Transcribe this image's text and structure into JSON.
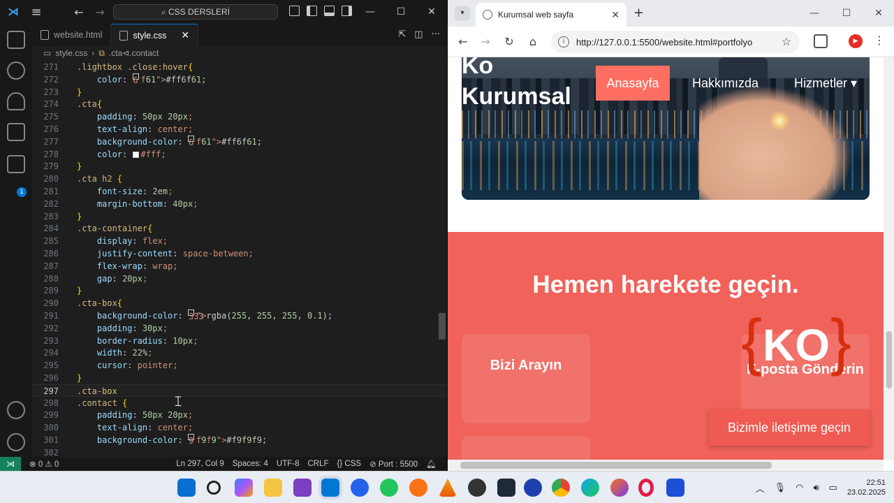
{
  "vscode": {
    "search": "CSS DERSLERİ",
    "tabs": [
      {
        "label": "website.html"
      },
      {
        "label": "style.css"
      }
    ],
    "breadcrumb": {
      "file": "style.css",
      "symbol": ".cta⊲.contact"
    },
    "code_lines": [
      {
        "n": "271",
        "text": ".lightbox .close:hover{"
      },
      {
        "n": "272",
        "text": "    color: #ff6f61;"
      },
      {
        "n": "273",
        "text": "}"
      },
      {
        "n": "274",
        "text": ".cta{"
      },
      {
        "n": "275",
        "text": "    padding: 50px 20px;"
      },
      {
        "n": "276",
        "text": "    text-align: center;"
      },
      {
        "n": "277",
        "text": "    background-color: #ff6f61;"
      },
      {
        "n": "278",
        "text": "    color: #fff;"
      },
      {
        "n": "279",
        "text": "}"
      },
      {
        "n": "280",
        "text": ".cta h2 {"
      },
      {
        "n": "281",
        "text": "    font-size: 2em;"
      },
      {
        "n": "282",
        "text": "    margin-bottom: 40px;"
      },
      {
        "n": "283",
        "text": "}"
      },
      {
        "n": "284",
        "text": ".cta-container{"
      },
      {
        "n": "285",
        "text": "    display: flex;"
      },
      {
        "n": "286",
        "text": "    justify-content: space-between;"
      },
      {
        "n": "287",
        "text": "    flex-wrap: wrap;"
      },
      {
        "n": "288",
        "text": "    gap: 20px;"
      },
      {
        "n": "289",
        "text": "}"
      },
      {
        "n": "290",
        "text": ".cta-box{"
      },
      {
        "n": "291",
        "text": "    background-color: rgba(255, 255, 255, 0.1);"
      },
      {
        "n": "292",
        "text": "    padding: 30px;"
      },
      {
        "n": "293",
        "text": "    border-radius: 10px;"
      },
      {
        "n": "294",
        "text": "    width: 22%;"
      },
      {
        "n": "295",
        "text": "    cursor: pointer;"
      },
      {
        "n": "296",
        "text": "}"
      },
      {
        "n": "297",
        "text": ".cta-box"
      },
      {
        "n": "298",
        "text": ".contact {"
      },
      {
        "n": "299",
        "text": "    padding: 50px 20px;"
      },
      {
        "n": "300",
        "text": "    text-align: center;"
      },
      {
        "n": "301",
        "text": "    background-color: #f9f9f9;"
      },
      {
        "n": "302",
        "text": ""
      }
    ],
    "status": {
      "problems": "⊗ 0 ⚠ 0",
      "position": "Ln 297, Col 9",
      "spaces": "Spaces: 4",
      "encoding": "UTF-8",
      "eol": "CRLF",
      "language": "{} CSS",
      "port": "⊘ Port : 5500"
    },
    "activity_badge": "1"
  },
  "browser": {
    "tab_title": "Kurumsal web sayfa",
    "url": "http://127.0.0.1:5500/website.html#portfolyo",
    "site": {
      "logo_line1": "Ko",
      "logo_line2": "Kurumsal",
      "nav": [
        "Anasayfa",
        "Hakkımızda",
        "Hizmetler ▾"
      ],
      "cta_title": "Hemen harekete geçin.",
      "cta_boxes": [
        "Bizi Arayın",
        "E-posta Gönderin"
      ],
      "contact_button": "Bizimle iletişime geçin",
      "watermark": "KO"
    }
  },
  "taskbar": {
    "time": "22:51",
    "date": "23.02.2025"
  }
}
